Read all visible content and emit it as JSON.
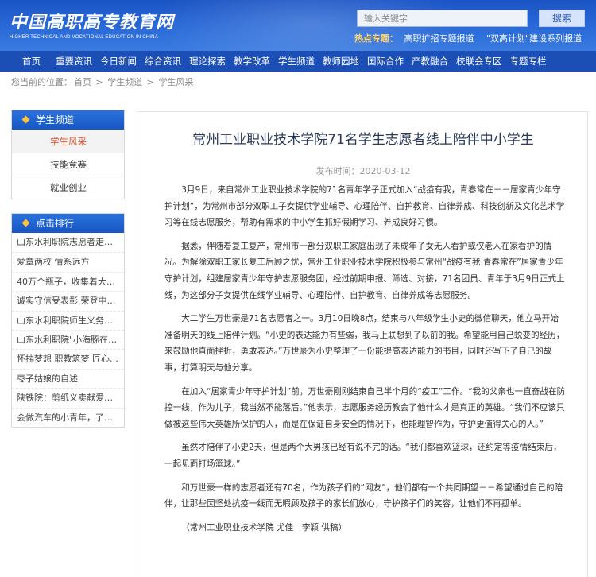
{
  "site": {
    "logo_title": "中国高职高专教育网",
    "logo_subtitle": "HIGHER TECHNICAL AND VOCATIONAL EDUCATION IN CHINA"
  },
  "search": {
    "placeholder": "输入关键字",
    "button": "搜索"
  },
  "hot_topics": {
    "label": "热点专题：",
    "items": [
      "高职扩招专题报道",
      "\"双高计划\"建设系列报道"
    ]
  },
  "nav": [
    "首页",
    "重要资讯",
    "今日新闻",
    "综合资讯",
    "理论探索",
    "教学改革",
    "学生频道",
    "教师园地",
    "国际合作",
    "产教融合",
    "校联会专区",
    "专题专栏"
  ],
  "breadcrumb": {
    "label": "您当前的位置：",
    "items": [
      "首页",
      "学生频道",
      "学生风采"
    ],
    "separator": ">"
  },
  "sidebar": {
    "channel_title": "学生频道",
    "channel_items": [
      "学生风采",
      "技能竞赛",
      "就业创业"
    ],
    "active_index": 0,
    "rank_title": "点击排行",
    "rank_items": [
      "山东水利职院志愿者走近...",
      "爱章两校 情系远方",
      "40万个瓶子，收集着大学...",
      "诚实守信受表彰 荣登中国...",
      "山东水利职院师生义务监...",
      "山东水利职院\"小海豚在行...",
      "怀揣梦想 职教筑梦 匠心圆...",
      "枣子姑娘的自述",
      "陕铁院：剪纸义卖献爱心 ...",
      "会做汽车的小青年，了解..."
    ]
  },
  "article": {
    "title": "常州工业职业技术学院71名学生志愿者线上陪伴中小学生",
    "date_label": "发布时间：",
    "date": "2020-03-12",
    "paragraphs": [
      "3月9日，来自常州工业职业技术学院的71名青年学子正式加入“战疫有我，青春常在－－居家青少年守护计划”，为常州市部分双职工子女提供学业辅导、心理陪伴、自护教育、自律养成、科技创新及文化艺术学习等在线志愿服务，帮助有需求的中小学生抓好假期学习、养成良好习惯。",
      "据悉，伴随着复工复产，常州市一部分双职工家庭出现了未成年子女无人看护或仅老人在家看护的情况。为解除双职工家长复工后顾之忧，常州工业职业技术学院积极参与常州“战疫有我 青春常在”居家青少年守护计划，组建居家青少年守护志愿服务团，经过前期申报、筛选、对接，71名团员、青年于3月9日正式上线，为这部分子女提供在线学业辅导、心理陪伴、自护教育、自律养成等志愿服务。",
      "大二学生万世豪是71名志愿者之一。3月10日晚8点，结束与八年级学生小史的微信聊天，他立马开始准备明天的线上陪伴计划。“小史的表达能力有些弱，我马上联想到了以前的我。希望能用自己蜕变的经历，来鼓励他直面挫折，勇敢表达。”万世豪为小史整理了一份能提高表达能力的书目，同时还写下了自己的故事，打算明天与他分享。",
      "在加入“居家青少年守护计划”前，万世豪刚刚结束自己半个月的“疫工”工作。“我的父亲也一直奋战在防控一线，作为儿子，我当然不能落后。”他表示，志愿服务经历教会了他什么才是真正的英雄。“我们不应该只做被这些伟大英雄所保护的人，而是在保证自身安全的情况下，也能理智作为，守护更值得关心的人。”",
      "虽然才陪伴了小史2天，但是两个大男孩已经有说不完的话。“我们都喜欢篮球，还约定等疫情结束后，一起见面打场篮球。”",
      "和万世豪一样的志愿者还有70名，作为孩子们的“网友”，他们都有一个共同期望－－希望通过自己的陪伴，让那些因坚处抗疫一线而无暇顾及孩子的家长们放心，守护孩子们的笑容，让他们不再孤单。",
      "（常州工业职业技术学院 尤佳　李颖 供稿）"
    ]
  },
  "colors": {
    "header_blue": "#2a6ad8",
    "nav_blue": "#1c4fb6",
    "active_orange": "#e0552a",
    "hot_label": "#ffd36b"
  }
}
